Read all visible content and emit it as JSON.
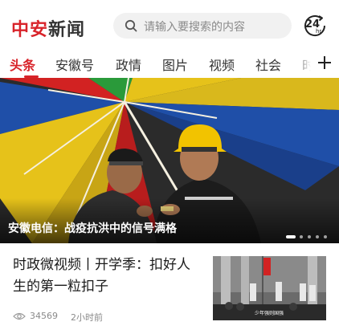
{
  "header": {
    "logo_part1": "中安",
    "logo_part2": "新闻",
    "search_placeholder": "请输入要搜索的内容",
    "hot24_number": "24",
    "hot24_unit": "hr"
  },
  "tabs": [
    {
      "label": "头条",
      "active": true
    },
    {
      "label": "安徽号",
      "active": false
    },
    {
      "label": "政情",
      "active": false
    },
    {
      "label": "图片",
      "active": false
    },
    {
      "label": "视频",
      "active": false
    },
    {
      "label": "社会",
      "active": false
    },
    {
      "label": "时",
      "active": false
    }
  ],
  "banner": {
    "caption": "安徽电信：战疫抗洪中的信号满格",
    "slide_count": 5,
    "active_slide": 0
  },
  "news": {
    "title": "时政微视频丨开学季：扣好人生的第一粒扣子",
    "views": "34569",
    "time": "2小时前",
    "thumb_caption": "少年强则国强"
  },
  "colors": {
    "accent": "#d8232a",
    "text": "#222222",
    "muted": "#8a8a8a"
  },
  "icons": [
    "search-icon",
    "clock-24h-icon",
    "plus-icon",
    "eye-icon"
  ]
}
